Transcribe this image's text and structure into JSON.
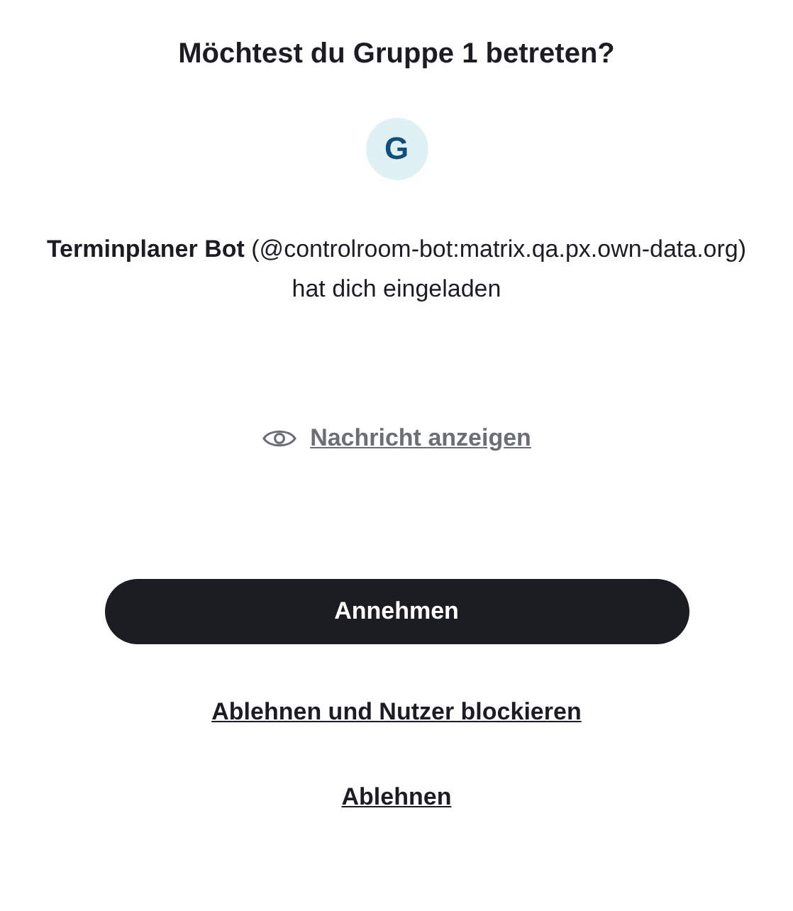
{
  "title": "Möchtest du Gruppe 1 betreten?",
  "avatar": {
    "letter": "G"
  },
  "invite_text": "**Terminplaner Bot** (@controlroom-bot:matrix.qa.px.own-data.org) hat dich eingeladen",
  "show_message_link": "Nachricht anzeigen",
  "accept_button": "Annehmen",
  "links": [
    "Ablehnen und Nutzer blockieren",
    "Ablehnen"
  ]
}
